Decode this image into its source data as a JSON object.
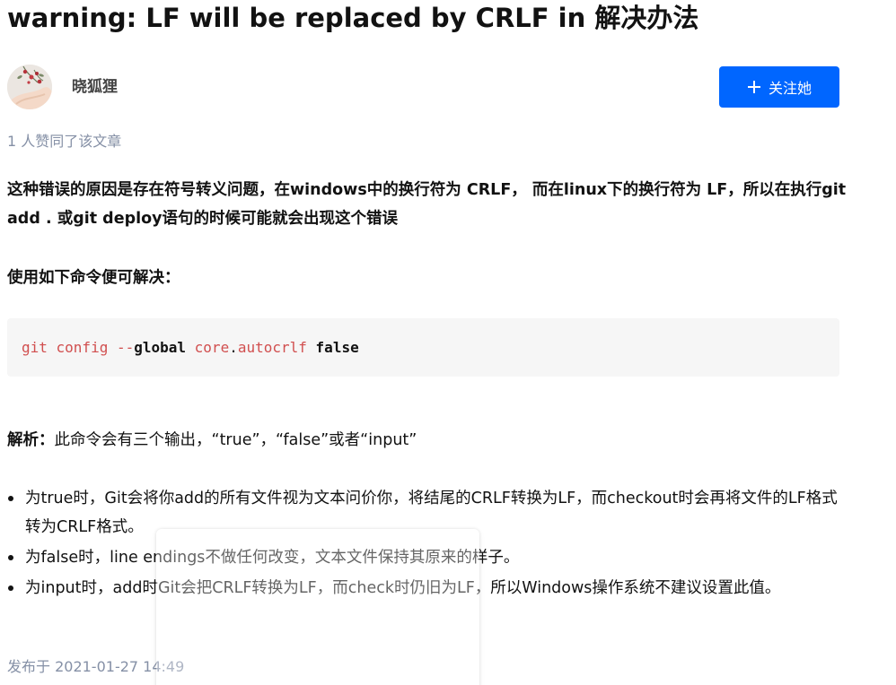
{
  "article": {
    "title": "warning: LF will be replaced by CRLF in 解决办法",
    "author": {
      "name": "晓狐狸",
      "avatar_icon": "avatar-photo"
    },
    "follow_button": {
      "label": "关注她",
      "icon": "plus-icon",
      "color": "#0066ff"
    },
    "like_text": "1 人赞同了该文章",
    "paragraph": "这种错误的原因是存在符号转义问题，在windows中的换行符为 CRLF， 而在linux下的换行符为 LF，所以在执行git add . 或git deploy语句的时候可能就会出现这个错误",
    "use_heading": "使用如下命令便可解决：",
    "code": {
      "t1": "git config --",
      "t2": "global",
      "t3": " core",
      "t4": ".",
      "t5": "autocrlf",
      "t6": " ",
      "t7": "false"
    },
    "analysis": {
      "label": "解析：",
      "text": "此命令会有三个输出，“true”，“false”或者“input”"
    },
    "bullets": [
      "为true时，Git会将你add的所有文件视为文本问价你，将结尾的CRLF转换为LF，而checkout时会再将文件的LF格式转为CRLF格式。",
      "为false时，line endings不做任何改变，文本文件保持其原来的样子。",
      "为input时，add时Git会把CRLF转换为LF，而check时仍旧为LF，所以Windows操作系统不建议设置此值。"
    ],
    "publish_time": "发布于 2021-01-27 14:49"
  },
  "colors": {
    "accent": "#0066ff",
    "muted_text": "#8590a6",
    "code_keyword": "#d14f4f",
    "code_background": "#f6f6f6"
  }
}
